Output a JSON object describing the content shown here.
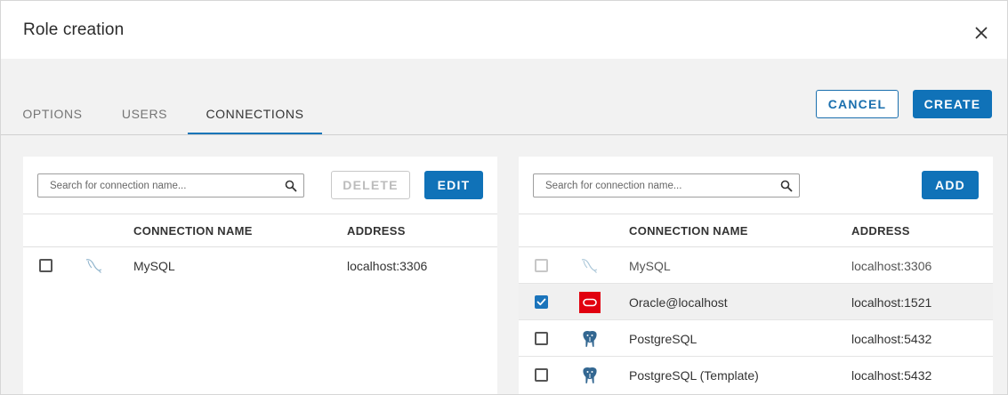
{
  "dialog": {
    "title": "Role creation",
    "close_icon": "close-icon"
  },
  "tabs": [
    {
      "label": "OPTIONS",
      "active": false
    },
    {
      "label": "USERS",
      "active": false
    },
    {
      "label": "CONNECTIONS",
      "active": true
    }
  ],
  "actions": {
    "cancel_label": "CANCEL",
    "create_label": "CREATE"
  },
  "colors": {
    "primary": "#1072b8",
    "oracle_red": "#e1000f",
    "postgres_blue": "#336791"
  },
  "left_panel": {
    "search_placeholder": "Search for connection name...",
    "delete_label": "DELETE",
    "edit_label": "EDIT",
    "columns": [
      "CONNECTION NAME",
      "ADDRESS"
    ],
    "rows": [
      {
        "name": "MySQL",
        "address": "localhost:3306",
        "icon": "mysql-icon",
        "checked": false,
        "disabled": false
      }
    ]
  },
  "right_panel": {
    "search_placeholder": "Search for connection name...",
    "add_label": "ADD",
    "columns": [
      "CONNECTION NAME",
      "ADDRESS"
    ],
    "rows": [
      {
        "name": "MySQL",
        "address": "localhost:3306",
        "icon": "mysql-icon",
        "checked": false,
        "disabled": true
      },
      {
        "name": "Oracle@localhost",
        "address": "localhost:1521",
        "icon": "oracle-icon",
        "checked": true,
        "disabled": false
      },
      {
        "name": "PostgreSQL",
        "address": "localhost:5432",
        "icon": "postgresql-icon",
        "checked": false,
        "disabled": false
      },
      {
        "name": "PostgreSQL (Template)",
        "address": "localhost:5432",
        "icon": "postgresql-icon",
        "checked": false,
        "disabled": false
      }
    ]
  }
}
